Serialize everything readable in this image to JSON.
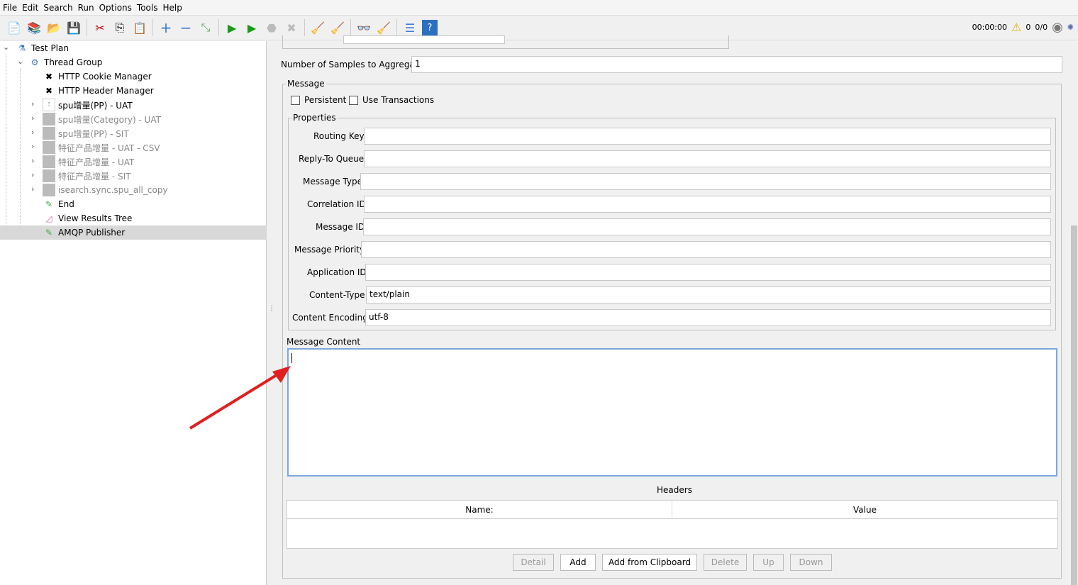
{
  "menu": [
    "File",
    "Edit",
    "Search",
    "Run",
    "Options",
    "Tools",
    "Help"
  ],
  "toolbar": {
    "icons": [
      "new-icon",
      "templates-icon",
      "open-icon",
      "save-icon",
      "cut-icon",
      "copy-icon",
      "paste-icon",
      "expand-icon",
      "collapse-icon",
      "toggle-icon",
      "start-icon",
      "start-no-pause-icon",
      "stop-icon",
      "shutdown-icon",
      "clear-icon",
      "clear-all-icon",
      "search-icon",
      "reset-search-icon",
      "function-helper-icon",
      "help-icon"
    ]
  },
  "status": {
    "timer": "00:00:00",
    "warnings": "0",
    "threads": "0/0"
  },
  "tree": [
    {
      "label": "Test Plan"
    },
    {
      "label": "Thread Group"
    },
    {
      "label": "HTTP Cookie Manager"
    },
    {
      "label": "HTTP Header Manager"
    },
    {
      "label": "spu增量(PP) - UAT"
    },
    {
      "label": "spu增量(Category) - UAT"
    },
    {
      "label": "spu增量(PP) - SIT"
    },
    {
      "label": "特征产品增量 - UAT - CSV"
    },
    {
      "label": "特征产品增量 - UAT"
    },
    {
      "label": "特征产品增量 - SIT"
    },
    {
      "label": "isearch.sync.spu_all_copy"
    },
    {
      "label": "End"
    },
    {
      "label": "View Results Tree"
    },
    {
      "label": "AMQP Publisher"
    }
  ],
  "form": {
    "samples_label": "Number of Samples to Aggregate",
    "samples_value": "1",
    "message_legend": "Message",
    "persistent": "Persistent",
    "use_transactions": "Use Transactions",
    "properties_legend": "Properties",
    "props": [
      {
        "label": "Routing Key",
        "value": ""
      },
      {
        "label": "Reply-To Queue",
        "value": ""
      },
      {
        "label": "Message Type",
        "value": ""
      },
      {
        "label": "Correlation ID",
        "value": ""
      },
      {
        "label": "Message ID",
        "value": ""
      },
      {
        "label": "Message Priority",
        "value": ""
      },
      {
        "label": "Application ID",
        "value": ""
      },
      {
        "label": "Content-Type",
        "value": "text/plain"
      },
      {
        "label": "Content Encoding",
        "value": "utf-8"
      }
    ],
    "content_label": "Message Content",
    "content_value": "",
    "headers_title": "Headers",
    "col_name": "Name:",
    "col_value": "Value",
    "buttons": [
      "Detail",
      "Add",
      "Add from Clipboard",
      "Delete",
      "Up",
      "Down"
    ]
  },
  "annotation_color": "#e02020"
}
